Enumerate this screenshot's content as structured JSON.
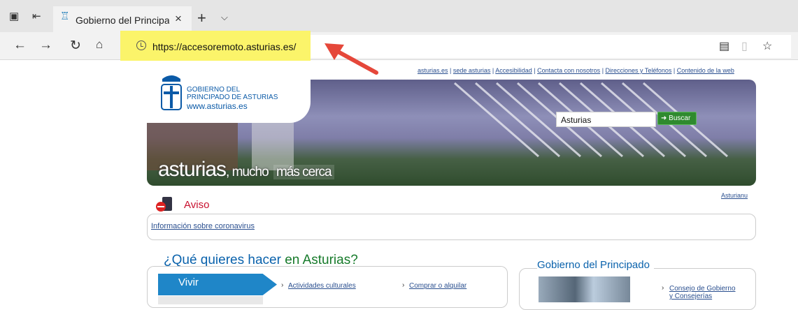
{
  "browser": {
    "tab_title": "Gobierno del Principado",
    "tab_close": "×",
    "new_tab": "+",
    "tab_list": "⌵",
    "url": "https://accesoremoto.asturias.es/",
    "icons": [
      "tab-preview-icon",
      "set-aside-tabs-icon",
      "site-favicon",
      "back-icon",
      "forward-icon",
      "refresh-icon",
      "home-icon",
      "reading-view-icon",
      "book-icon",
      "favorite-star-icon"
    ]
  },
  "site": {
    "top_links": [
      "asturias.es",
      "sede asturias",
      "Accesibilidad",
      "Contacta con nosotros",
      "Direcciones y Teléfonos",
      "Contenido de la web"
    ],
    "logo_line1": "GOBIERNO DEL",
    "logo_line2": "PRINCIPADO DE ASTURIAS",
    "logo_url": "www.asturias.es",
    "search_value": "Asturias",
    "search_button": "Buscar",
    "slogan_a": "asturias",
    "slogan_b": ", mucho",
    "slogan_c": "más cerca",
    "asturianu": "Asturianu",
    "aviso_title": "Aviso",
    "aviso_link": "Información sobre coronavirus",
    "q_heading_a": "¿Qué quieres hacer ",
    "q_heading_b": "en Asturias?",
    "vivir": "Vivir",
    "links": [
      "Actividades culturales",
      "Comprar o alquilar"
    ],
    "g_heading": "Gobierno del Principado",
    "g_link_line1": "Consejo de Gobierno",
    "g_link_line2": "y Consejerías"
  }
}
